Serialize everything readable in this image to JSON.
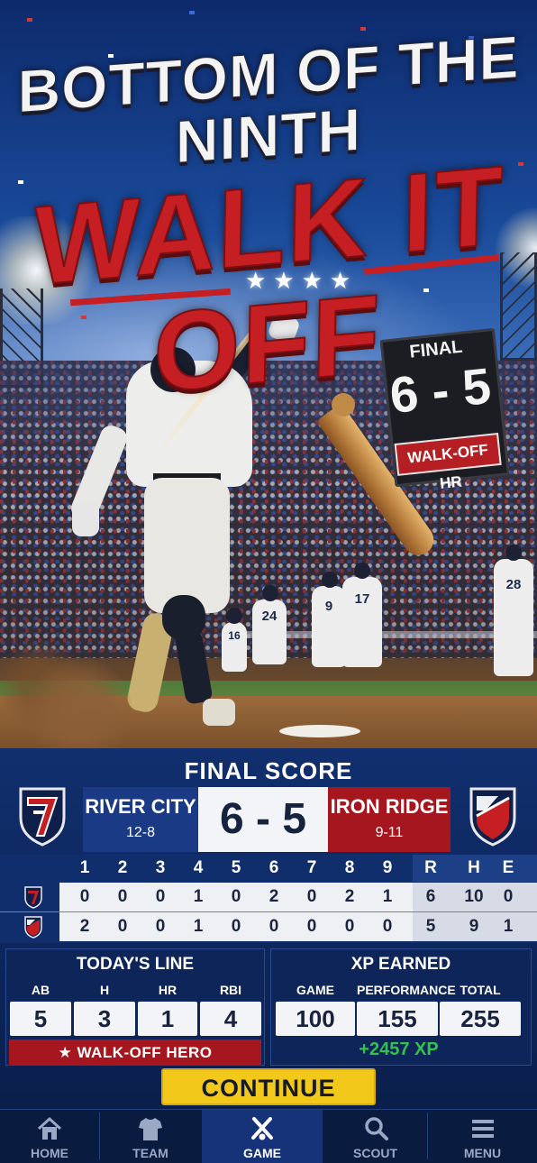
{
  "hero": {
    "headline_top": "BOTTOM OF THE NINTH",
    "headline_main": "WALK IT OFF",
    "stars": "★★★★",
    "sign_final": "FINAL",
    "sign_score": "6 - 5",
    "sign_banner": "WALK-OFF HR",
    "jersey_numbers": [
      "24",
      "16",
      "9",
      "17",
      "28"
    ]
  },
  "scoreboard": {
    "title": "FINAL SCORE",
    "home": {
      "name": "RIVER CITY",
      "record": "12-8",
      "color": "#1a3a86"
    },
    "away": {
      "name": "IRON RIDGE",
      "record": "9-11",
      "color": "#a6161f"
    },
    "score": "6 - 5"
  },
  "linescore": {
    "innings": [
      "1",
      "2",
      "3",
      "4",
      "5",
      "6",
      "7",
      "8",
      "9"
    ],
    "totals_headers": [
      "R",
      "H",
      "E"
    ],
    "rows": [
      {
        "team": "home",
        "innings": [
          "0",
          "0",
          "0",
          "1",
          "0",
          "2",
          "0",
          "2",
          "1"
        ],
        "totals": [
          "6",
          "10",
          "0"
        ]
      },
      {
        "team": "away",
        "innings": [
          "2",
          "0",
          "0",
          "1",
          "0",
          "0",
          "0",
          "0",
          "0"
        ],
        "totals": [
          "5",
          "9",
          "1"
        ]
      }
    ]
  },
  "todays_line": {
    "title": "TODAY'S LINE",
    "stats": [
      {
        "label": "AB",
        "value": "5"
      },
      {
        "label": "H",
        "value": "3"
      },
      {
        "label": "HR",
        "value": "1"
      },
      {
        "label": "RBI",
        "value": "4"
      }
    ],
    "hero_badge": "★  WALK-OFF HERO"
  },
  "xp": {
    "title": "XP EARNED",
    "stats": [
      {
        "label": "GAME",
        "value": "100"
      },
      {
        "label": "PERFORMANCE",
        "value": "155"
      },
      {
        "label": "TOTAL",
        "value": "255"
      }
    ],
    "gain": "+2457 XP"
  },
  "continue_label": "CONTINUE",
  "nav": [
    {
      "label": "HOME",
      "icon": "home-icon"
    },
    {
      "label": "TEAM",
      "icon": "jersey-icon"
    },
    {
      "label": "GAME",
      "icon": "crossed-bats-icon",
      "active": true
    },
    {
      "label": "SCOUT",
      "icon": "magnifier-icon"
    },
    {
      "label": "MENU",
      "icon": "menu-icon"
    }
  ],
  "colors": {
    "accent": "#f2c81a",
    "home": "#1a3a86",
    "away": "#a6161f",
    "xp_green": "#33c24a"
  }
}
